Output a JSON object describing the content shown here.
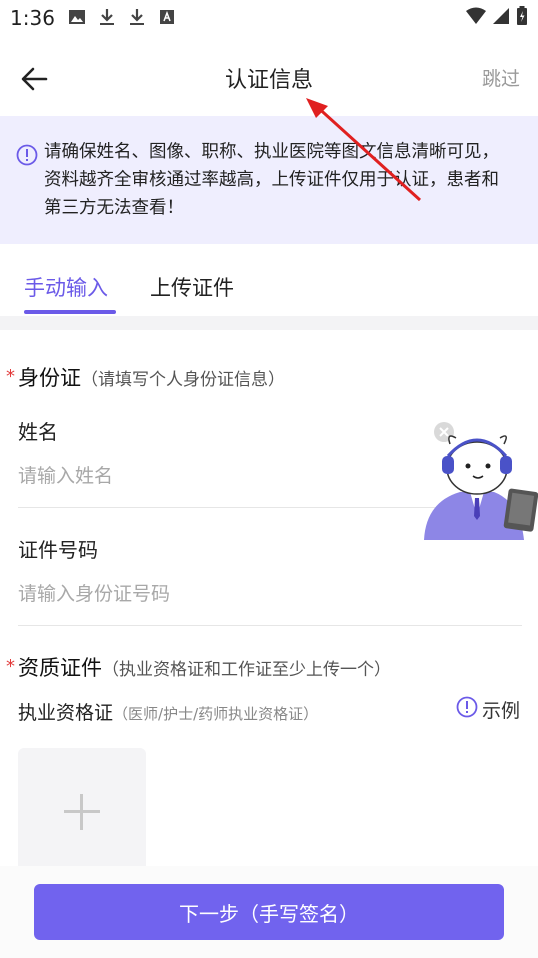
{
  "status": {
    "time": "1:36"
  },
  "header": {
    "title": "认证信息",
    "skip": "跳过"
  },
  "notice": {
    "text": "请确保姓名、图像、职称、执业医院等图文信息清晰可见，资料越齐全审核通过率越高，上传证件仅用于认证，患者和第三方无法查看！"
  },
  "tabs": [
    {
      "label": "手动输入",
      "active": true
    },
    {
      "label": "上传证件",
      "active": false
    }
  ],
  "id_section": {
    "required_mark": "*",
    "title": "身份证",
    "subtitle": "（请填写个人身份证信息）",
    "name_label": "姓名",
    "name_placeholder": "请输入姓名",
    "id_label": "证件号码",
    "id_placeholder": "请输入身份证号码"
  },
  "qual_section": {
    "required_mark": "*",
    "title": "资质证件",
    "subtitle": "（执业资格证和工作证至少上传一个）",
    "cert_label": "执业资格证",
    "cert_hint": "（医师/护士/药师执业资格证）",
    "example": "示例"
  },
  "footer": {
    "next_label": "下一步（手写签名）"
  },
  "colors": {
    "accent": "#6b5ae8",
    "button": "#7163ee",
    "notice_bg": "#efeefe",
    "required": "#e23a3a",
    "annotation": "#e02020"
  }
}
